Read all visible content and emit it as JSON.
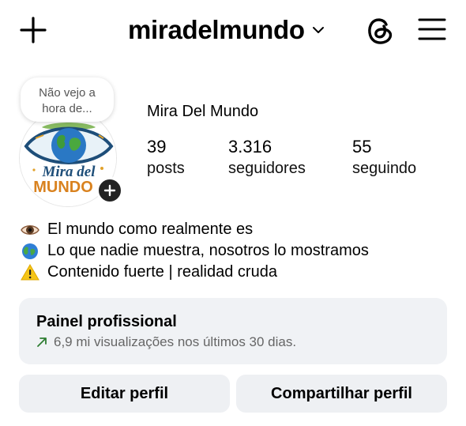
{
  "header": {
    "username": "miradelmundo",
    "icons": [
      "plus-icon",
      "chevron-down-icon",
      "threads-icon",
      "hamburger-menu-icon"
    ]
  },
  "profile": {
    "note_lines": [
      "Não vejo a",
      "hora de..."
    ],
    "display_name": "Mira Del Mundo",
    "avatar_logo_text": [
      "Mira del",
      "MUNDO"
    ],
    "stats": [
      {
        "value": "39",
        "label": "posts"
      },
      {
        "value": "3.316",
        "label": "seguidores"
      },
      {
        "value": "55",
        "label": "seguindo"
      }
    ]
  },
  "bio": [
    {
      "icon": "eye-emoji",
      "text": "El mundo como realmente es"
    },
    {
      "icon": "globe-emoji",
      "text": "Lo que nadie muestra, nosotros lo mostramos"
    },
    {
      "icon": "warning-emoji",
      "text": "Contenido fuerte | realidad cruda"
    }
  ],
  "dashboard": {
    "title": "Painel profissional",
    "subtitle": "6,9 mi visualizações nos últimos 30 dias.",
    "trend_color": "#2e7d32"
  },
  "buttons": {
    "edit": "Editar perfil",
    "share": "Compartilhar perfil"
  }
}
